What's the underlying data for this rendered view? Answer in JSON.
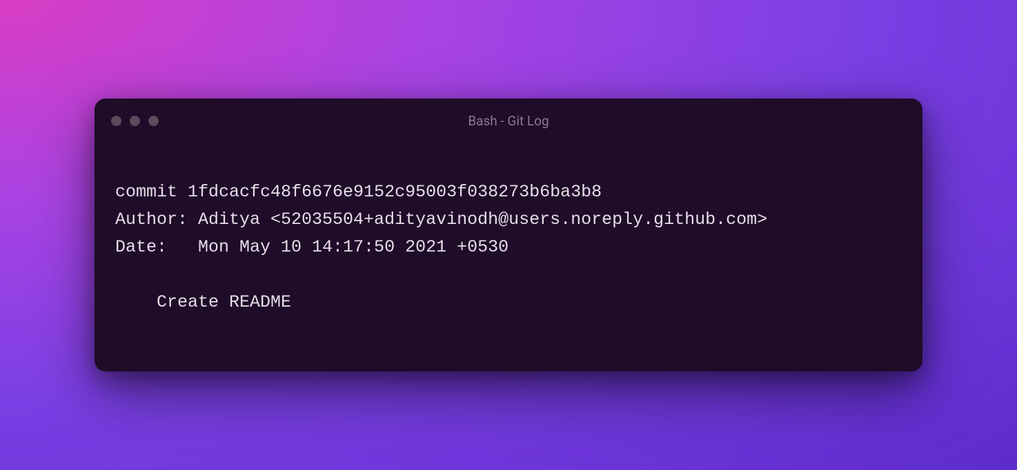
{
  "window": {
    "title": "Bash - Git Log"
  },
  "terminal": {
    "line1": "commit 1fdcacfc48f6676e9152c95003f038273b6ba3b8",
    "line2": "Author: Aditya <52035504+adityavinodh@users.noreply.github.com>",
    "line3": "Date:   Mon May 10 14:17:50 2021 +0530",
    "line4": "",
    "line5": "    Create README"
  }
}
